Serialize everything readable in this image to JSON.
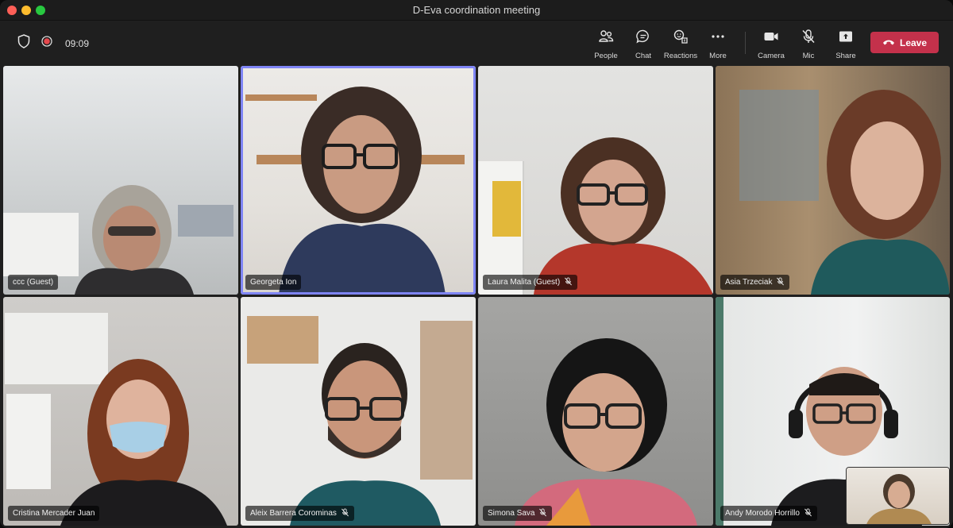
{
  "window": {
    "title": "D-Eva coordination meeting"
  },
  "toolbar": {
    "timer": "09:09",
    "people_label": "People",
    "chat_label": "Chat",
    "reactions_label": "Reactions",
    "more_label": "More",
    "camera_label": "Camera",
    "mic_label": "Mic",
    "share_label": "Share",
    "leave_label": "Leave"
  },
  "participants": [
    {
      "name": "ccc (Guest)",
      "muted": false
    },
    {
      "name": "Georgeta Ion",
      "muted": false,
      "speaking": true
    },
    {
      "name": "Laura Malita (Guest)",
      "muted": true
    },
    {
      "name": "Asia Trzeciak",
      "muted": true
    },
    {
      "name": "Cristina Mercader Juan",
      "muted": false
    },
    {
      "name": "Aleix Barrera Corominas",
      "muted": true
    },
    {
      "name": "Simona Sava",
      "muted": true
    },
    {
      "name": "Andy Morodo Horrillo",
      "muted": true
    }
  ],
  "colors": {
    "leave": "#c4314b",
    "active_speaker": "#7f85f5"
  }
}
